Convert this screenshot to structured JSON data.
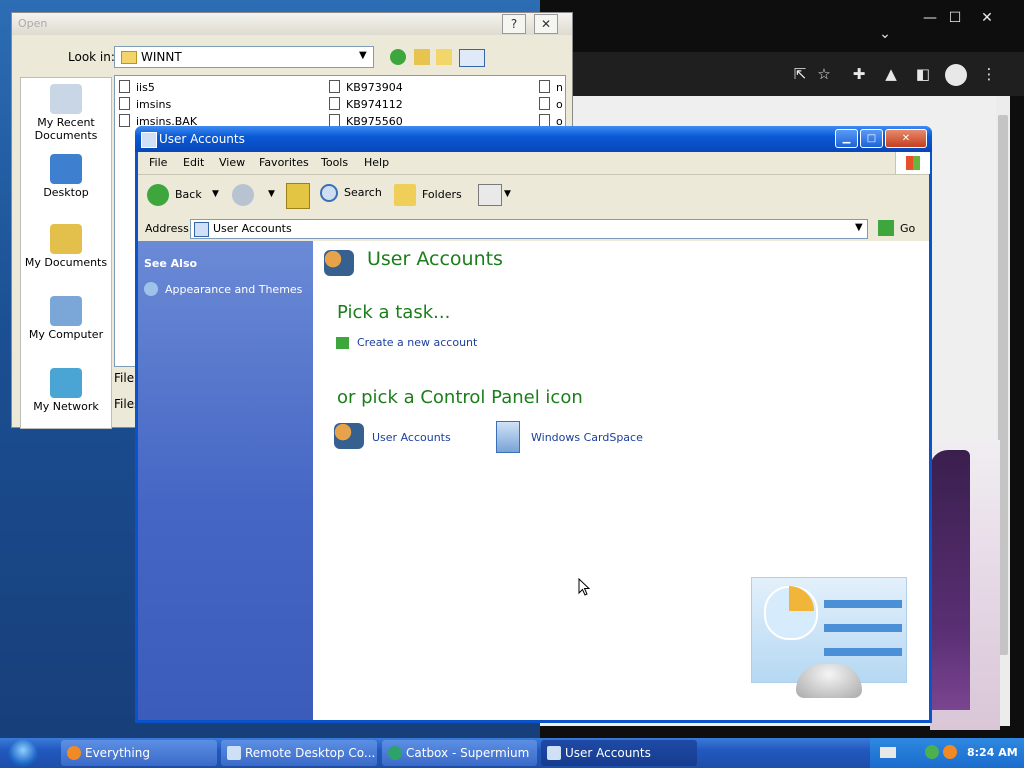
{
  "open_dialog": {
    "title": "Open",
    "help_btn": "?",
    "close_btn": "✕",
    "look_in_label": "Look in:",
    "look_in_value": "WINNT",
    "places": [
      "My Recent Documents",
      "Desktop",
      "My Documents",
      "My Computer",
      "My Network"
    ],
    "files_col1": [
      "iis5",
      "imsins",
      "imsins.BAK"
    ],
    "files_col2": [
      "KB973904",
      "KB974112",
      "KB975560"
    ],
    "files_col3": [
      "n",
      "o",
      "o"
    ],
    "file_name_label": "File",
    "files_of_type_label": "Files"
  },
  "browser": {
    "caption_min": "—",
    "caption_max": "☐",
    "caption_close": "✕",
    "chevron": "⌄"
  },
  "user_accounts": {
    "window_title": "User Accounts",
    "menu": [
      "File",
      "Edit",
      "View",
      "Favorites",
      "Tools",
      "Help"
    ],
    "toolbar": {
      "back": "Back",
      "search": "Search",
      "folders": "Folders"
    },
    "address_label": "Address",
    "address_value": "User Accounts",
    "go_label": "Go",
    "see_also": "See Also",
    "see_also_items": [
      "Appearance and Themes"
    ],
    "main_title": "User Accounts",
    "pick_task": "Pick a task...",
    "tasks": [
      "Create a new account"
    ],
    "or_pick": "or pick a Control Panel icon",
    "icons": [
      "User Accounts",
      "Windows CardSpace"
    ]
  },
  "taskbar": {
    "buttons": [
      "Everything",
      "Remote Desktop Co...",
      "Catbox - Supermium",
      "User Accounts"
    ],
    "active_button": "User Accounts",
    "clock": "8:24 AM"
  },
  "colors": {
    "xp_blue": "#0a53c8",
    "task_green": "#1b7e1b",
    "link_blue": "#1b3f9c",
    "side_panel": "#4566c4"
  }
}
